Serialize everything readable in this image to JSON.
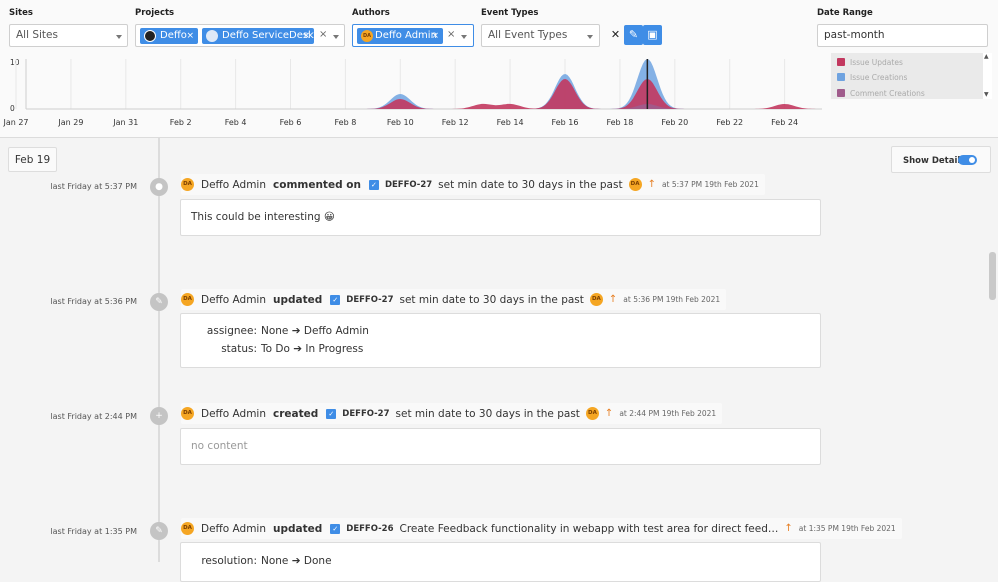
{
  "filters": {
    "sites": {
      "label": "Sites",
      "placeholder": "All Sites"
    },
    "projects": {
      "label": "Projects",
      "chips": [
        "Deffo",
        "Deffo ServiceDesk"
      ]
    },
    "authors": {
      "label": "Authors",
      "chips": [
        "Deffo Admin"
      ],
      "chip_avatar": "DA"
    },
    "event_types": {
      "label": "Event Types",
      "placeholder": "All Event Types"
    },
    "date_range": {
      "label": "Date Range",
      "value": "past-month"
    }
  },
  "chart_data": {
    "type": "area",
    "title": "",
    "xlabel": "",
    "ylabel": "",
    "ylim": [
      0,
      10
    ],
    "y_ticks": [
      "10",
      "0"
    ],
    "x_ticks": [
      "Jan 27",
      "Jan 29",
      "Jan 31",
      "Feb 2",
      "Feb 4",
      "Feb 6",
      "Feb 8",
      "Feb 10",
      "Feb 12",
      "Feb 14",
      "Feb 16",
      "Feb 18",
      "Feb 20",
      "Feb 22",
      "Feb 24"
    ],
    "legend_position": "right",
    "series": [
      {
        "name": "Issue Updates",
        "color": "#c2385f",
        "peaks": [
          {
            "date": "Feb 10",
            "value": 2
          },
          {
            "date": "Feb 13",
            "value": 1
          },
          {
            "date": "Feb 14",
            "value": 1
          },
          {
            "date": "Feb 16",
            "value": 6
          },
          {
            "date": "Feb 19",
            "value": 6
          },
          {
            "date": "Feb 24",
            "value": 1
          }
        ]
      },
      {
        "name": "Issue Creations",
        "color": "#6fa3e0",
        "peaks": [
          {
            "date": "Feb 10",
            "value": 3
          },
          {
            "date": "Feb 16",
            "value": 7
          },
          {
            "date": "Feb 19",
            "value": 10
          }
        ]
      },
      {
        "name": "Comment Creations",
        "color": "#a05c8c",
        "peaks": [
          {
            "date": "Feb 19",
            "value": 1
          }
        ]
      }
    ]
  },
  "timeline": {
    "date_label": "Feb 19",
    "show_details_label": "Show Details",
    "events": [
      {
        "time": "last Friday at 5:37 PM",
        "author": "Deffo Admin",
        "action": "commented on",
        "key": "DEFFO-27",
        "title": "set min date to 30 days in the past",
        "when": "at 5:37 PM 19th Feb 2021",
        "body": "This could be interesting 😀"
      },
      {
        "time": "last Friday at 5:36 PM",
        "author": "Deffo Admin",
        "action": "updated",
        "key": "DEFFO-27",
        "title": "set min date to 30 days in the past",
        "when": "at 5:36 PM 19th Feb 2021",
        "changes": [
          {
            "field": "assignee:",
            "from": "None",
            "to": "Deffo Admin"
          },
          {
            "field": "status:",
            "from": "To Do",
            "to": "In Progress"
          }
        ]
      },
      {
        "time": "last Friday at 2:44 PM",
        "author": "Deffo Admin",
        "action": "created",
        "key": "DEFFO-27",
        "title": "set min date to 30 days in the past",
        "when": "at 2:44 PM 19th Feb 2021",
        "body": "no content"
      },
      {
        "time": "last Friday at 1:35 PM",
        "author": "Deffo Admin",
        "action": "updated",
        "key": "DEFFO-26",
        "title": "Create Feedback functionality in webapp with test area for direct feed…",
        "when": "at 1:35 PM 19th Feb 2021",
        "changes": [
          {
            "field": "resolution:",
            "from": "None",
            "to": "Done"
          }
        ]
      }
    ]
  },
  "avatar_initials": "DA"
}
